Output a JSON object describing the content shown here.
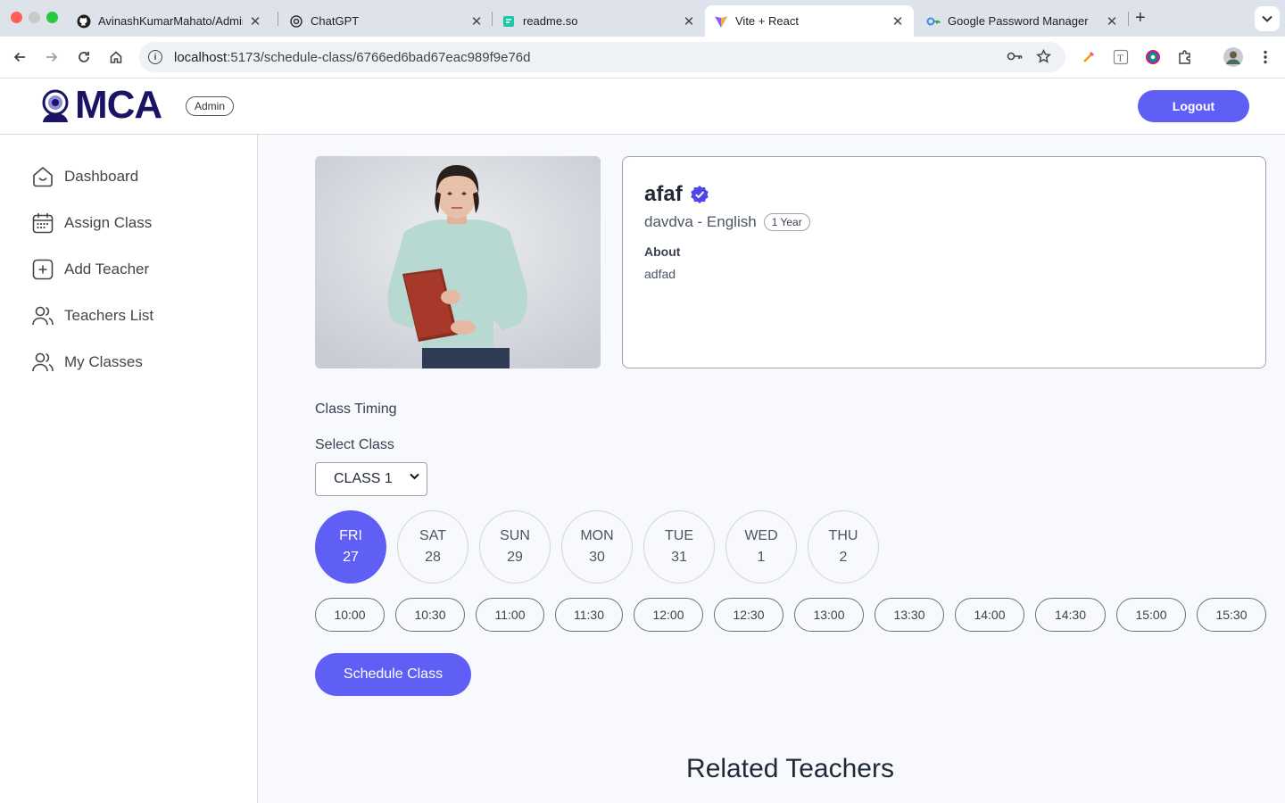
{
  "browser": {
    "tabs": [
      {
        "title": "AvinashKumarMahato/Admin-",
        "icon": "github-icon"
      },
      {
        "title": "ChatGPT",
        "icon": "chatgpt-icon"
      },
      {
        "title": "readme.so",
        "icon": "readme-icon"
      },
      {
        "title": "Vite + React",
        "icon": "vite-icon"
      },
      {
        "title": "Google Password Manager",
        "icon": "password-manager-icon"
      }
    ],
    "url_host": "localhost",
    "url_path": ":5173/schedule-class/6766ed6bad67eac989f9e76d"
  },
  "header": {
    "logo_text": "MCA",
    "role_badge": "Admin",
    "logout_label": "Logout"
  },
  "sidebar": {
    "items": [
      {
        "label": "Dashboard",
        "icon": "home-icon"
      },
      {
        "label": "Assign Class",
        "icon": "calendar-icon"
      },
      {
        "label": "Add Teacher",
        "icon": "add-square-icon"
      },
      {
        "label": "Teachers List",
        "icon": "people-icon"
      },
      {
        "label": "My Classes",
        "icon": "people-icon"
      }
    ]
  },
  "teacher": {
    "name": "afaf",
    "subtitle": "davdva - English",
    "experience": "1 Year",
    "about_label": "About",
    "about_text": "adfad"
  },
  "booking": {
    "class_timing_label": "Class Timing",
    "select_class_label": "Select Class",
    "selected_class": "CLASS 1",
    "days": [
      {
        "day": "FRI",
        "date": "27",
        "selected": true
      },
      {
        "day": "SAT",
        "date": "28",
        "selected": false
      },
      {
        "day": "SUN",
        "date": "29",
        "selected": false
      },
      {
        "day": "MON",
        "date": "30",
        "selected": false
      },
      {
        "day": "TUE",
        "date": "31",
        "selected": false
      },
      {
        "day": "WED",
        "date": "1",
        "selected": false
      },
      {
        "day": "THU",
        "date": "2",
        "selected": false
      }
    ],
    "slots": [
      "10:00",
      "10:30",
      "11:00",
      "11:30",
      "12:00",
      "12:30",
      "13:00",
      "13:30",
      "14:00",
      "14:30",
      "15:00",
      "15:30"
    ],
    "schedule_label": "Schedule Class"
  },
  "related_title": "Related Teachers",
  "colors": {
    "accent": "#5f5ff6",
    "logo": "#1b1464"
  }
}
